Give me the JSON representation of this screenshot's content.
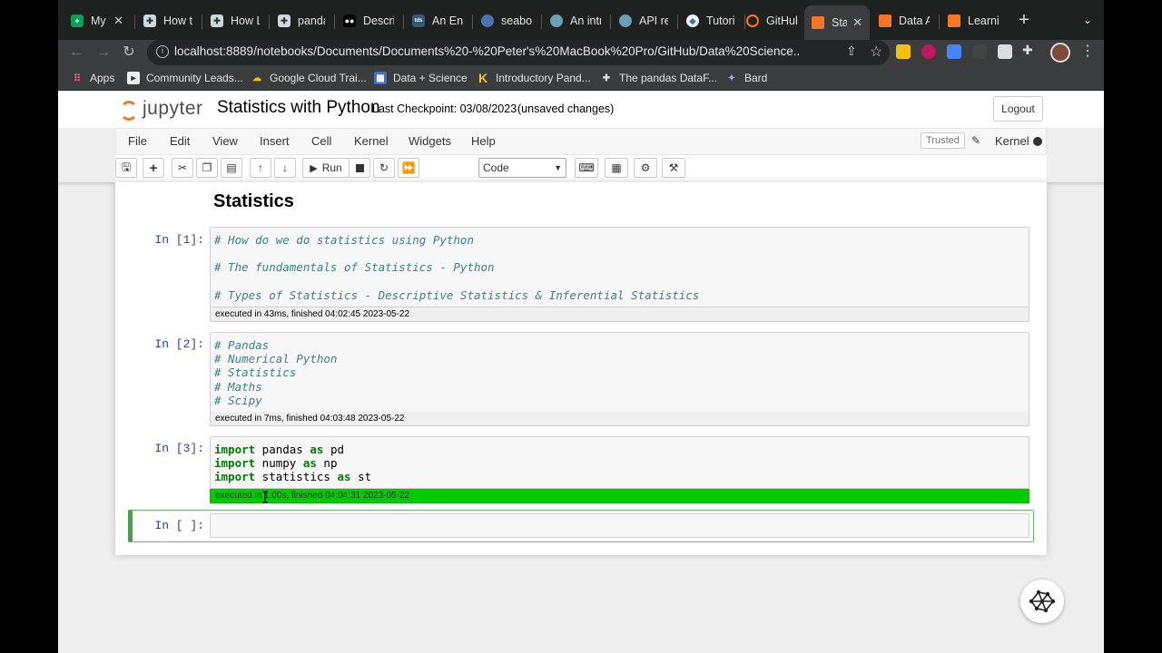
{
  "browser": {
    "tabs": [
      {
        "label": "My",
        "icon": "google-sheets-icon",
        "color": "#0f9d58"
      },
      {
        "label": "How to",
        "icon": "puzzle-icon",
        "color": "#cfd8dc"
      },
      {
        "label": "How Lo",
        "icon": "puzzle-icon",
        "color": "#cfd8dc"
      },
      {
        "label": "pandas",
        "icon": "puzzle-icon",
        "color": "#cfd8dc"
      },
      {
        "label": "Descrip",
        "icon": "medium-icon",
        "color": "#ffffff"
      },
      {
        "label": "An End",
        "icon": "tds-icon",
        "color": "#355876"
      },
      {
        "label": "seaborn",
        "icon": "seaborn-icon",
        "color": "#4c72b0"
      },
      {
        "label": "An intro",
        "icon": "globe-icon",
        "color": "#6a9fb5"
      },
      {
        "label": "API refe",
        "icon": "globe-icon",
        "color": "#6a9fb5"
      },
      {
        "label": "Tutorial",
        "icon": "python-icon",
        "color": "#f2f2f2"
      },
      {
        "label": "GitHub",
        "icon": "jupyter-icon",
        "color": "#f37726"
      },
      {
        "label": "Stat",
        "icon": "notebook-icon",
        "color": "#f37726"
      },
      {
        "label": "Data Ar",
        "icon": "notebook-icon",
        "color": "#f37726"
      },
      {
        "label": "Learnin",
        "icon": "notebook-icon",
        "color": "#f37726"
      }
    ],
    "url": "localhost:8889/notebooks/Documents/Documents%20-%20Peter's%20MacBook%20Pro/GitHub/Data%20Science...",
    "bookmarks": [
      {
        "label": "Apps",
        "icon": "apps-grid-icon"
      },
      {
        "label": "Community Leads...",
        "icon": "bookmark-icon"
      },
      {
        "label": "Google Cloud Trai...",
        "icon": "google-cloud-icon"
      },
      {
        "label": "Data + Science",
        "icon": "dashboard-icon"
      },
      {
        "label": "Introductory Pand...",
        "icon": "kaggle-icon"
      },
      {
        "label": "The pandas DataF...",
        "icon": "puzzle-icon"
      },
      {
        "label": "Bard",
        "icon": "bard-icon"
      }
    ]
  },
  "jupyter": {
    "logo_text": "jupyter",
    "notebook_name": "Statistics with Python",
    "checkpoint": "Last Checkpoint: 03/08/2023",
    "unsaved": "(unsaved changes)",
    "logout": "Logout",
    "menu": [
      "File",
      "Edit",
      "View",
      "Insert",
      "Cell",
      "Kernel",
      "Widgets",
      "Help"
    ],
    "trusted": "Trusted",
    "kernel_label": "Kernel",
    "run_label": "Run",
    "cell_type": "Code"
  },
  "notebook": {
    "heading": "Statistics",
    "cells": [
      {
        "prompt": "In [1]:",
        "lines": [
          "# How do we do statistics using Python",
          "",
          "# The fundamentals of Statistics - Python",
          "",
          "# Types of Statistics - Descriptive Statistics & Inferential Statistics"
        ],
        "exec": "executed in 43ms, finished 04:02:45 2023-05-22"
      },
      {
        "prompt": "In [2]:",
        "lines": [
          "# Pandas",
          "# Numerical Python",
          "# Statistics",
          "# Maths",
          "# Scipy"
        ],
        "exec": "executed in 7ms, finished 04:03:48 2023-05-22"
      },
      {
        "prompt": "In [3]:",
        "code": [
          {
            "kw1": "import",
            "mod": " pandas ",
            "kw2": "as",
            "alias": " pd"
          },
          {
            "kw1": "import",
            "mod": " numpy ",
            "kw2": "as",
            "alias": " np"
          },
          {
            "kw1": "import",
            "mod": " statistics ",
            "kw2": "as",
            "alias": " st"
          }
        ],
        "exec": "executed in 1.00s, finished 04:04:31 2023-05-22"
      },
      {
        "prompt": "In [ ]:"
      }
    ]
  },
  "colors": {
    "jupyter_orange": "#f37726",
    "prompt_blue": "#303f9f",
    "comment": "#408080",
    "keyword": "#008000",
    "exec_green": "#00cc00"
  }
}
